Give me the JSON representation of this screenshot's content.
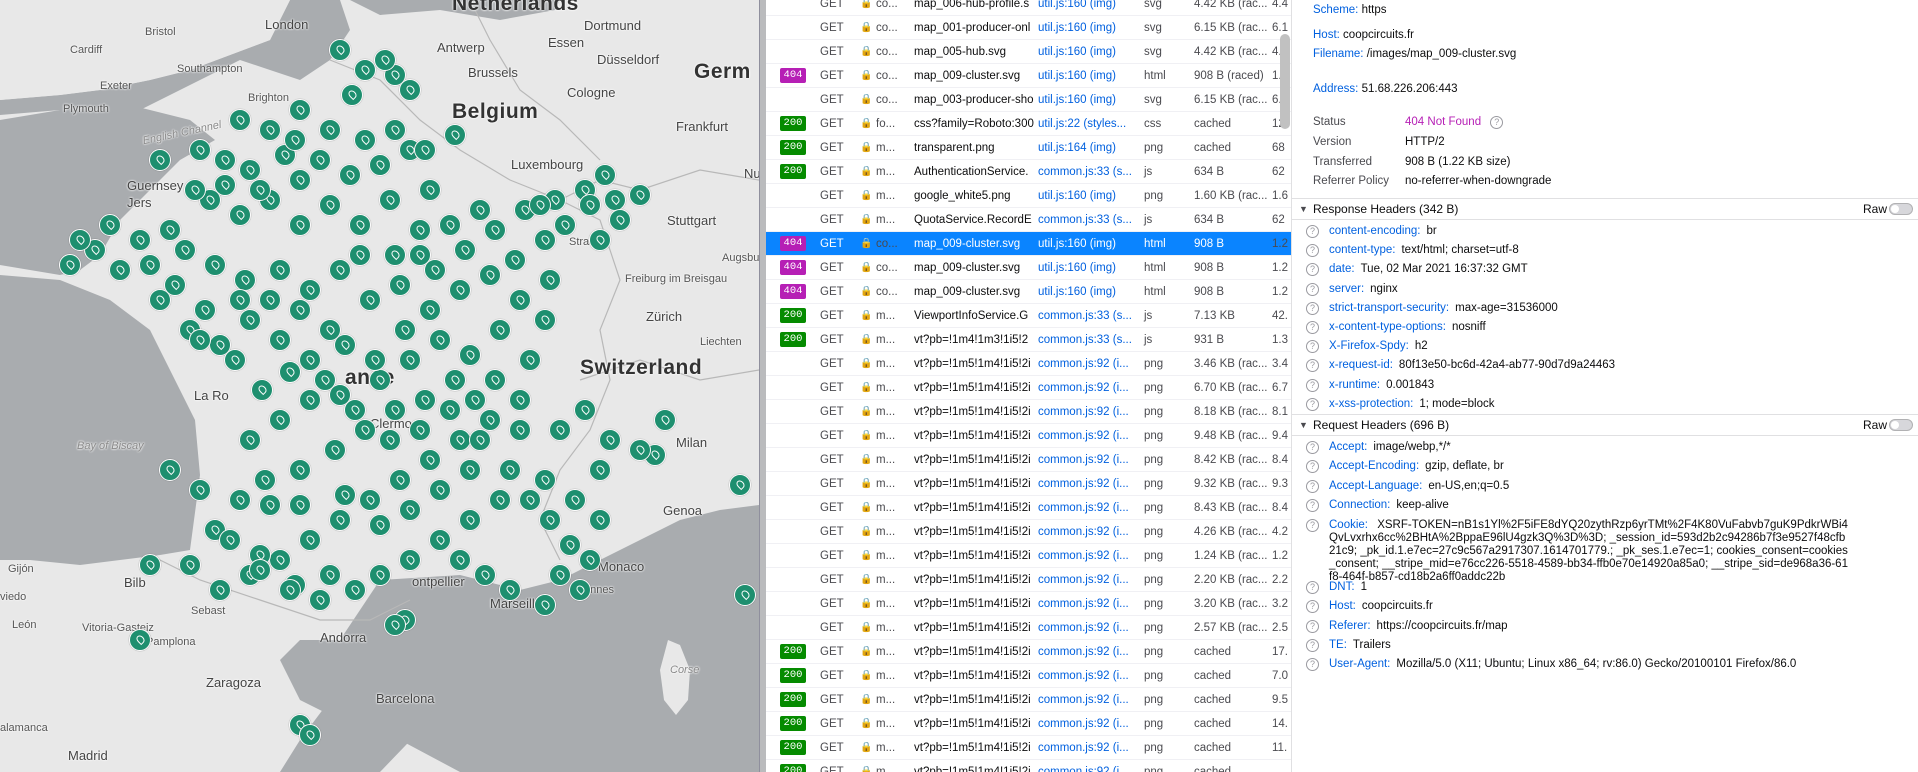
{
  "map": {
    "cities": [
      {
        "name": "Netherlands",
        "cls": "country"
      },
      {
        "name": "London",
        "cls": ""
      },
      {
        "name": "Bristol",
        "cls": "small"
      },
      {
        "name": "Cardiff",
        "cls": "small"
      },
      {
        "name": "Southampton",
        "cls": "small"
      },
      {
        "name": "Exeter",
        "cls": "small"
      },
      {
        "name": "Plymouth",
        "cls": "small"
      },
      {
        "name": "Brighton",
        "cls": "small"
      },
      {
        "name": "Antwerp",
        "cls": ""
      },
      {
        "name": "Brussels",
        "cls": ""
      },
      {
        "name": "Belgium",
        "cls": "country"
      },
      {
        "name": "Dortmund",
        "cls": ""
      },
      {
        "name": "Essen",
        "cls": ""
      },
      {
        "name": "Düsseldorf",
        "cls": ""
      },
      {
        "name": "Cologne",
        "cls": ""
      },
      {
        "name": "Germ",
        "cls": "country"
      },
      {
        "name": "Frankfurt",
        "cls": ""
      },
      {
        "name": "Luxembourg",
        "cls": ""
      },
      {
        "name": "Nu",
        "cls": ""
      },
      {
        "name": "Stuttgart",
        "cls": ""
      },
      {
        "name": "Augsbu",
        "cls": "small"
      },
      {
        "name": "Strasb",
        "cls": "small"
      },
      {
        "name": "Freiburg im Breisgau",
        "cls": "small"
      },
      {
        "name": "Zürich",
        "cls": ""
      },
      {
        "name": "Liechten",
        "cls": "small"
      },
      {
        "name": "Switzerland",
        "cls": "country"
      },
      {
        "name": "Guernsey",
        "cls": ""
      },
      {
        "name": "Jers",
        "cls": ""
      },
      {
        "name": "English Channel",
        "cls": "sea"
      },
      {
        "name": "ance",
        "cls": "country"
      },
      {
        "name": "La Ro",
        "cls": ""
      },
      {
        "name": "Clermo",
        "cls": ""
      },
      {
        "name": "Bay of Biscay",
        "cls": "sea"
      },
      {
        "name": "Milan",
        "cls": ""
      },
      {
        "name": "Genoa",
        "cls": ""
      },
      {
        "name": "Monaco",
        "cls": ""
      },
      {
        "name": "Marseille",
        "cls": ""
      },
      {
        "name": "ontpellier",
        "cls": ""
      },
      {
        "name": "Gijón",
        "cls": "small"
      },
      {
        "name": "viedo",
        "cls": "small"
      },
      {
        "name": "León",
        "cls": "small"
      },
      {
        "name": "Bilb",
        "cls": ""
      },
      {
        "name": "Sebast",
        "cls": "small"
      },
      {
        "name": "Pamplona",
        "cls": "small"
      },
      {
        "name": "Vitoria-Gasteiz",
        "cls": "small"
      },
      {
        "name": "Andorra",
        "cls": ""
      },
      {
        "name": "Zaragoza",
        "cls": ""
      },
      {
        "name": "Barcelona",
        "cls": ""
      },
      {
        "name": "Corse",
        "cls": "sea"
      },
      {
        "name": "annes",
        "cls": "small"
      },
      {
        "name": "Madrid",
        "cls": ""
      },
      {
        "name": "alamanca",
        "cls": "small"
      }
    ]
  },
  "network": {
    "rows": [
      {
        "status": "",
        "method": "GET",
        "domain": "co...",
        "file": "map_006-hub-profile.s",
        "init": "util.js:160 (img)",
        "type": "svg",
        "transferred": "4.42 KB (rac...",
        "size": "4.4"
      },
      {
        "status": "",
        "method": "GET",
        "domain": "co...",
        "file": "map_001-producer-onl",
        "init": "util.js:160 (img)",
        "type": "svg",
        "transferred": "6.15 KB (rac...",
        "size": "6.1"
      },
      {
        "status": "",
        "method": "GET",
        "domain": "co...",
        "file": "map_005-hub.svg",
        "init": "util.js:160 (img)",
        "type": "svg",
        "transferred": "4.42 KB (rac...",
        "size": "4.4"
      },
      {
        "status": "404",
        "method": "GET",
        "domain": "co...",
        "file": "map_009-cluster.svg",
        "init": "util.js:160 (img)",
        "type": "html",
        "transferred": "908 B (raced)",
        "size": "1.2"
      },
      {
        "status": "",
        "method": "GET",
        "domain": "co...",
        "file": "map_003-producer-sho",
        "init": "util.js:160 (img)",
        "type": "svg",
        "transferred": "6.15 KB (rac...",
        "size": "6.1"
      },
      {
        "status": "200",
        "method": "GET",
        "domain": "fo...",
        "file": "css?family=Roboto:300",
        "init": "util.js:22 (styles...",
        "type": "css",
        "transferred": "cached",
        "size": "12."
      },
      {
        "status": "200",
        "method": "GET",
        "domain": "m...",
        "file": "transparent.png",
        "init": "util.js:164 (img)",
        "type": "png",
        "transferred": "cached",
        "size": "68"
      },
      {
        "status": "200",
        "method": "GET",
        "domain": "m...",
        "file": "AuthenticationService.",
        "init": "common.js:33 (s...",
        "type": "js",
        "transferred": "634 B",
        "size": "62"
      },
      {
        "status": "",
        "method": "GET",
        "domain": "m...",
        "file": "google_white5.png",
        "init": "util.js:160 (img)",
        "type": "png",
        "transferred": "1.60 KB (rac...",
        "size": "1.6"
      },
      {
        "status": "",
        "method": "GET",
        "domain": "m...",
        "file": "QuotaService.RecordE",
        "init": "common.js:33 (s...",
        "type": "js",
        "transferred": "634 B",
        "size": "62"
      },
      {
        "status": "404",
        "method": "GET",
        "domain": "co...",
        "file": "map_009-cluster.svg",
        "init": "util.js:160 (img)",
        "type": "html",
        "transferred": "908 B",
        "size": "1.2",
        "selected": true
      },
      {
        "status": "404",
        "method": "GET",
        "domain": "co...",
        "file": "map_009-cluster.svg",
        "init": "util.js:160 (img)",
        "type": "html",
        "transferred": "908 B",
        "size": "1.2"
      },
      {
        "status": "404",
        "method": "GET",
        "domain": "co...",
        "file": "map_009-cluster.svg",
        "init": "util.js:160 (img)",
        "type": "html",
        "transferred": "908 B",
        "size": "1.2"
      },
      {
        "status": "200",
        "method": "GET",
        "domain": "m...",
        "file": "ViewportInfoService.G",
        "init": "common.js:33 (s...",
        "type": "js",
        "transferred": "7.13 KB",
        "size": "42."
      },
      {
        "status": "200",
        "method": "GET",
        "domain": "m...",
        "file": "vt?pb=!1m4!1m3!1i5!2",
        "init": "common.js:33 (s...",
        "type": "js",
        "transferred": "931 B",
        "size": "1.3"
      },
      {
        "status": "",
        "method": "GET",
        "domain": "m...",
        "file": "vt?pb=!1m5!1m4!1i5!2i",
        "init": "common.js:92 (i...",
        "type": "png",
        "transferred": "3.46 KB (rac...",
        "size": "3.4"
      },
      {
        "status": "",
        "method": "GET",
        "domain": "m...",
        "file": "vt?pb=!1m5!1m4!1i5!2i",
        "init": "common.js:92 (i...",
        "type": "png",
        "transferred": "6.70 KB (rac...",
        "size": "6.7"
      },
      {
        "status": "",
        "method": "GET",
        "domain": "m...",
        "file": "vt?pb=!1m5!1m4!1i5!2i",
        "init": "common.js:92 (i...",
        "type": "png",
        "transferred": "8.18 KB (rac...",
        "size": "8.1"
      },
      {
        "status": "",
        "method": "GET",
        "domain": "m...",
        "file": "vt?pb=!1m5!1m4!1i5!2i",
        "init": "common.js:92 (i...",
        "type": "png",
        "transferred": "9.48 KB (rac...",
        "size": "9.4"
      },
      {
        "status": "",
        "method": "GET",
        "domain": "m...",
        "file": "vt?pb=!1m5!1m4!1i5!2i",
        "init": "common.js:92 (i...",
        "type": "png",
        "transferred": "8.42 KB (rac...",
        "size": "8.4"
      },
      {
        "status": "",
        "method": "GET",
        "domain": "m...",
        "file": "vt?pb=!1m5!1m4!1i5!2i",
        "init": "common.js:92 (i...",
        "type": "png",
        "transferred": "9.32 KB (rac...",
        "size": "9.3"
      },
      {
        "status": "",
        "method": "GET",
        "domain": "m...",
        "file": "vt?pb=!1m5!1m4!1i5!2i",
        "init": "common.js:92 (i...",
        "type": "png",
        "transferred": "8.43 KB (rac...",
        "size": "8.4"
      },
      {
        "status": "",
        "method": "GET",
        "domain": "m...",
        "file": "vt?pb=!1m5!1m4!1i5!2i",
        "init": "common.js:92 (i...",
        "type": "png",
        "transferred": "4.26 KB (rac...",
        "size": "4.2"
      },
      {
        "status": "",
        "method": "GET",
        "domain": "m...",
        "file": "vt?pb=!1m5!1m4!1i5!2i",
        "init": "common.js:92 (i...",
        "type": "png",
        "transferred": "1.24 KB (rac...",
        "size": "1.2"
      },
      {
        "status": "",
        "method": "GET",
        "domain": "m...",
        "file": "vt?pb=!1m5!1m4!1i5!2i",
        "init": "common.js:92 (i...",
        "type": "png",
        "transferred": "2.20 KB (rac...",
        "size": "2.2"
      },
      {
        "status": "",
        "method": "GET",
        "domain": "m...",
        "file": "vt?pb=!1m5!1m4!1i5!2i",
        "init": "common.js:92 (i...",
        "type": "png",
        "transferred": "3.20 KB (rac...",
        "size": "3.2"
      },
      {
        "status": "",
        "method": "GET",
        "domain": "m...",
        "file": "vt?pb=!1m5!1m4!1i5!2i",
        "init": "common.js:92 (i...",
        "type": "png",
        "transferred": "2.57 KB (rac...",
        "size": "2.5"
      },
      {
        "status": "200",
        "method": "GET",
        "domain": "m...",
        "file": "vt?pb=!1m5!1m4!1i5!2i",
        "init": "common.js:92 (i...",
        "type": "png",
        "transferred": "cached",
        "size": "17."
      },
      {
        "status": "200",
        "method": "GET",
        "domain": "m...",
        "file": "vt?pb=!1m5!1m4!1i5!2i",
        "init": "common.js:92 (i...",
        "type": "png",
        "transferred": "cached",
        "size": "7.0"
      },
      {
        "status": "200",
        "method": "GET",
        "domain": "m...",
        "file": "vt?pb=!1m5!1m4!1i5!2i",
        "init": "common.js:92 (i...",
        "type": "png",
        "transferred": "cached",
        "size": "9.5"
      },
      {
        "status": "200",
        "method": "GET",
        "domain": "m...",
        "file": "vt?pb=!1m5!1m4!1i5!2i",
        "init": "common.js:92 (i...",
        "type": "png",
        "transferred": "cached",
        "size": "14."
      },
      {
        "status": "200",
        "method": "GET",
        "domain": "m...",
        "file": "vt?pb=!1m5!1m4!1i5!2i",
        "init": "common.js:92 (i...",
        "type": "png",
        "transferred": "cached",
        "size": "11."
      },
      {
        "status": "200",
        "method": "GET",
        "domain": "m...",
        "file": "vt?pb=!1m5!1m4!1i5!2i",
        "init": "common.js:92 (i...",
        "type": "png",
        "transferred": "cached",
        "size": ""
      }
    ]
  },
  "details": {
    "top": {
      "scheme_label": "Scheme:",
      "scheme": "https",
      "host_label": "Host:",
      "host": "coopcircuits.fr",
      "filename_label": "Filename:",
      "filename": "/images/map_009-cluster.svg",
      "address_label": "Address:",
      "address": "51.68.226.206:443"
    },
    "status": {
      "status_label": "Status",
      "status_code": "404",
      "status_text": "Not Found",
      "version_label": "Version",
      "version": "HTTP/2",
      "transferred_label": "Transferred",
      "transferred": "908 B (1.22 KB size)",
      "referrer_label": "Referrer Policy",
      "referrer": "no-referrer-when-downgrade"
    },
    "response_title": "Response Headers (342 B)",
    "request_title": "Request Headers (696 B)",
    "raw_label": "Raw",
    "response_headers": [
      {
        "name": "content-encoding:",
        "value": "br"
      },
      {
        "name": "content-type:",
        "value": "text/html; charset=utf-8"
      },
      {
        "name": "date:",
        "value": "Tue, 02 Mar 2021 16:37:32 GMT"
      },
      {
        "name": "server:",
        "value": "nginx"
      },
      {
        "name": "strict-transport-security:",
        "value": "max-age=31536000"
      },
      {
        "name": "x-content-type-options:",
        "value": "nosniff"
      },
      {
        "name": "X-Firefox-Spdy:",
        "value": "h2"
      },
      {
        "name": "x-request-id:",
        "value": "80f13e50-bc6d-42a4-ab77-90d7d9a24463"
      },
      {
        "name": "x-runtime:",
        "value": "0.001843"
      },
      {
        "name": "x-xss-protection:",
        "value": "1; mode=block"
      }
    ],
    "request_headers": [
      {
        "name": "Accept:",
        "value": "image/webp,*/*"
      },
      {
        "name": "Accept-Encoding:",
        "value": "gzip, deflate, br"
      },
      {
        "name": "Accept-Language:",
        "value": "en-US,en;q=0.5"
      },
      {
        "name": "Connection:",
        "value": "keep-alive"
      },
      {
        "name": "Cookie:",
        "value": "XSRF-TOKEN=nB1s1Yl%2F5iFE8dYQ20zythRzp6yrTMt%2F4K80VuFabvb7guK9PdkrWBi4QvLvxrhx6cc%2BHtA%2BppaE96lU4gzk3Q%3D%3D; _session_id=593d2b2c94286b7f3e9527f48cfb21c9; _pk_id.1.e7ec=27c9c567a2917307.1614701779.; _pk_ses.1.e7ec=1; cookies_consent=cookies_consent; __stripe_mid=e76cc226-5518-4589-bb34-ffb0e70e14920a85a0; __stripe_sid=de968a36-61f8-464f-b857-cd18b2a6ff0addc22b"
      },
      {
        "name": "DNT:",
        "value": "1"
      },
      {
        "name": "Host:",
        "value": "coopcircuits.fr"
      },
      {
        "name": "Referer:",
        "value": "https://coopcircuits.fr/map"
      },
      {
        "name": "TE:",
        "value": "Trailers"
      },
      {
        "name": "User-Agent:",
        "value": "Mozilla/5.0 (X11; Ubuntu; Linux x86_64; rv:86.0) Gecko/20100101 Firefox/86.0"
      }
    ]
  }
}
